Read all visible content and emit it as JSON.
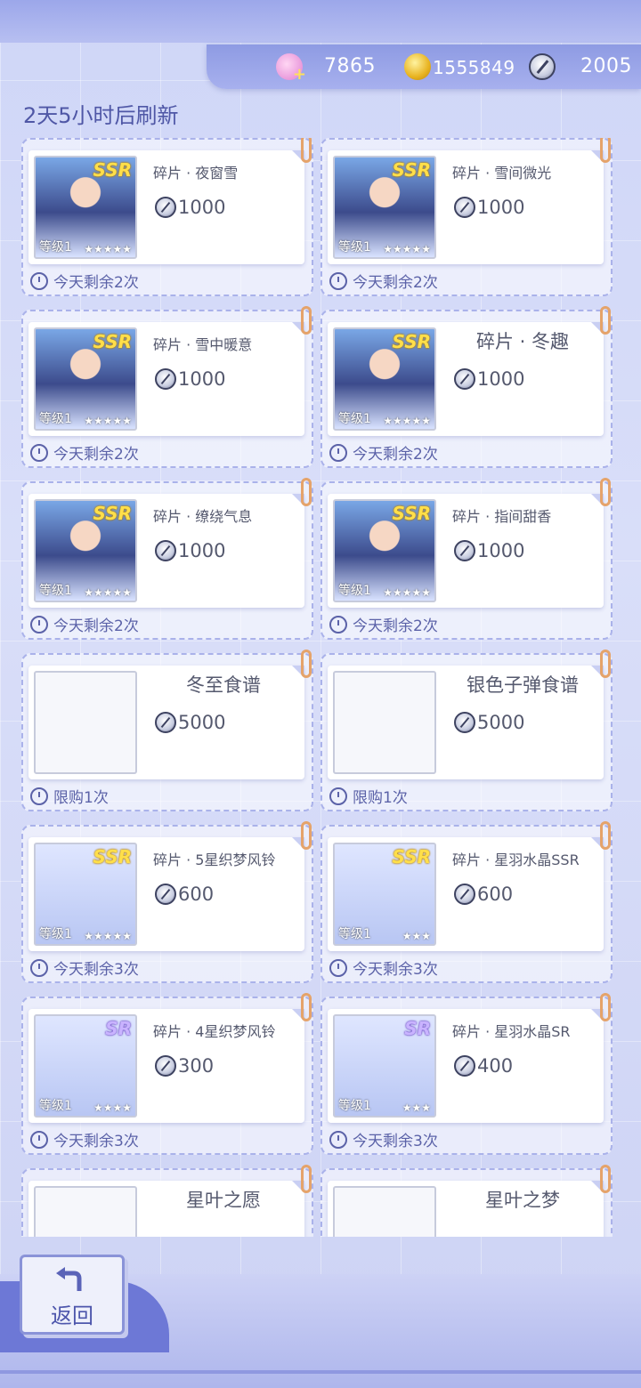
{
  "header": {
    "currencies": [
      {
        "icon": "swan-plus-icon",
        "value": "7865"
      },
      {
        "icon": "gold-coin-icon",
        "value": "1555849"
      },
      {
        "icon": "compass-icon",
        "value": "2005"
      }
    ],
    "refresh_text": "2天5小时后刷新"
  },
  "shop": {
    "items": [
      {
        "name": "碎片 · 夜窗雪",
        "price": "1000",
        "limit": "今天剩余2次",
        "rarity": "SSR",
        "level": "等级1",
        "stars": "★★★★★",
        "thumb": "portrait"
      },
      {
        "name": "碎片 · 雪间微光",
        "price": "1000",
        "limit": "今天剩余2次",
        "rarity": "SSR",
        "level": "等级1",
        "stars": "★★★★★",
        "thumb": "portrait"
      },
      {
        "name": "碎片 · 雪中暖意",
        "price": "1000",
        "limit": "今天剩余2次",
        "rarity": "SSR",
        "level": "等级1",
        "stars": "★★★★★",
        "thumb": "portrait"
      },
      {
        "name": "碎片 · 冬趣",
        "price": "1000",
        "limit": "今天剩余2次",
        "rarity": "SSR",
        "level": "等级1",
        "stars": "★★★★★",
        "thumb": "portrait"
      },
      {
        "name": "碎片 · 缭绕气息",
        "price": "1000",
        "limit": "今天剩余2次",
        "rarity": "SSR",
        "level": "等级1",
        "stars": "★★★★★",
        "thumb": "portrait"
      },
      {
        "name": "碎片 · 指间甜香",
        "price": "1000",
        "limit": "今天剩余2次",
        "rarity": "SSR",
        "level": "等级1",
        "stars": "★★★★★",
        "thumb": "portrait"
      },
      {
        "name": "冬至食谱",
        "price": "5000",
        "limit": "限购1次",
        "rarity": "",
        "level": "",
        "stars": "",
        "thumb": "food"
      },
      {
        "name": "银色子弹食谱",
        "price": "5000",
        "limit": "限购1次",
        "rarity": "",
        "level": "",
        "stars": "",
        "thumb": "food"
      },
      {
        "name": "碎片 · 5星织梦风铃",
        "price": "600",
        "limit": "今天剩余3次",
        "rarity": "SSR",
        "level": "等级1",
        "stars": "★★★★★",
        "thumb": "item"
      },
      {
        "name": "碎片 · 星羽水晶SSR",
        "price": "600",
        "limit": "今天剩余3次",
        "rarity": "SSR",
        "level": "等级1",
        "stars": "★★★",
        "thumb": "item"
      },
      {
        "name": "碎片 · 4星织梦风铃",
        "price": "300",
        "limit": "今天剩余3次",
        "rarity": "SR",
        "level": "等级1",
        "stars": "★★★★",
        "thumb": "item"
      },
      {
        "name": "碎片 · 星羽水晶SR",
        "price": "400",
        "limit": "今天剩余3次",
        "rarity": "SR",
        "level": "等级1",
        "stars": "★★★",
        "thumb": "item"
      },
      {
        "name": "星叶之愿",
        "price": "",
        "limit": "",
        "rarity": "",
        "level": "",
        "stars": "",
        "thumb": "food"
      },
      {
        "name": "星叶之梦",
        "price": "",
        "limit": "",
        "rarity": "",
        "level": "",
        "stars": "",
        "thumb": "food"
      }
    ]
  },
  "footer": {
    "back_label": "返回"
  }
}
